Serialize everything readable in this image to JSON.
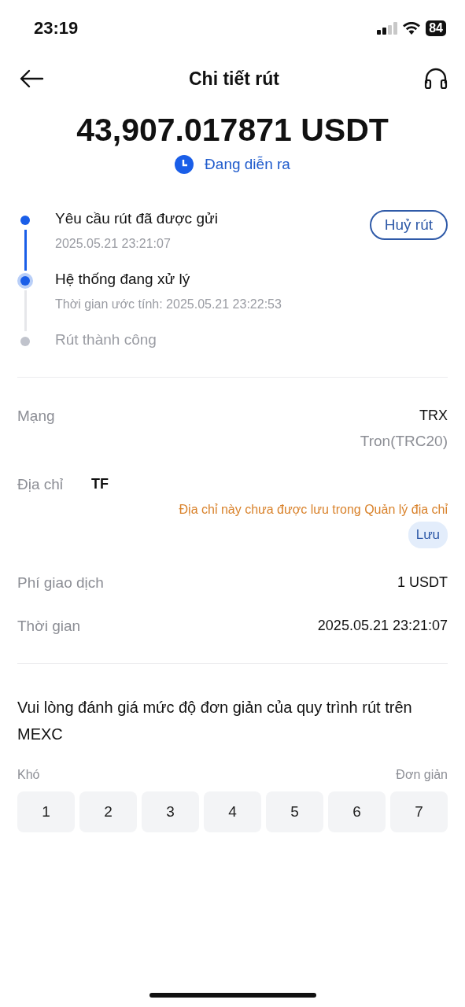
{
  "status_bar": {
    "time": "23:19",
    "battery": "84"
  },
  "header": {
    "title": "Chi tiết rút"
  },
  "amount": "43,907.017871 USDT",
  "status": "Đang diễn ra",
  "timeline": [
    {
      "title": "Yêu cầu rút đã được gửi",
      "subtitle": "2025.05.21 23:21:07",
      "completed": true,
      "current": false
    },
    {
      "title": "Hệ thống đang xử lý",
      "subtitle": "Thời gian ước tính: 2025.05.21 23:22:53",
      "completed": false,
      "current": true
    },
    {
      "title": "Rút thành công",
      "completed": false,
      "current": false
    }
  ],
  "cancel_button": "Huỷ rút",
  "details": [
    {
      "label": "Mạng",
      "value": "TRX",
      "sub": "Tron(TRC20)"
    },
    {
      "label": "Địa chỉ",
      "value": "TF",
      "warning": "Địa chỉ này chưa được lưu trong Quản lý địa chỉ",
      "action": "Lưu"
    },
    {
      "label": "Phí giao dịch",
      "value": "1 USDT"
    },
    {
      "label": "Thời gian",
      "value": "2025.05.21 23:21:07"
    }
  ],
  "rating": {
    "question": "Vui lòng đánh giá mức độ đơn giản của quy trình rút trên MEXC",
    "low_label": "Khó",
    "high_label": "Đơn giản",
    "options": [
      {
        "label": "1",
        "selected": false
      },
      {
        "label": "2",
        "selected": false
      },
      {
        "label": "3",
        "selected": false
      },
      {
        "label": "4",
        "selected": false
      },
      {
        "label": "5",
        "selected": false
      },
      {
        "label": "6",
        "selected": false
      },
      {
        "label": "7",
        "selected": false
      }
    ]
  }
}
